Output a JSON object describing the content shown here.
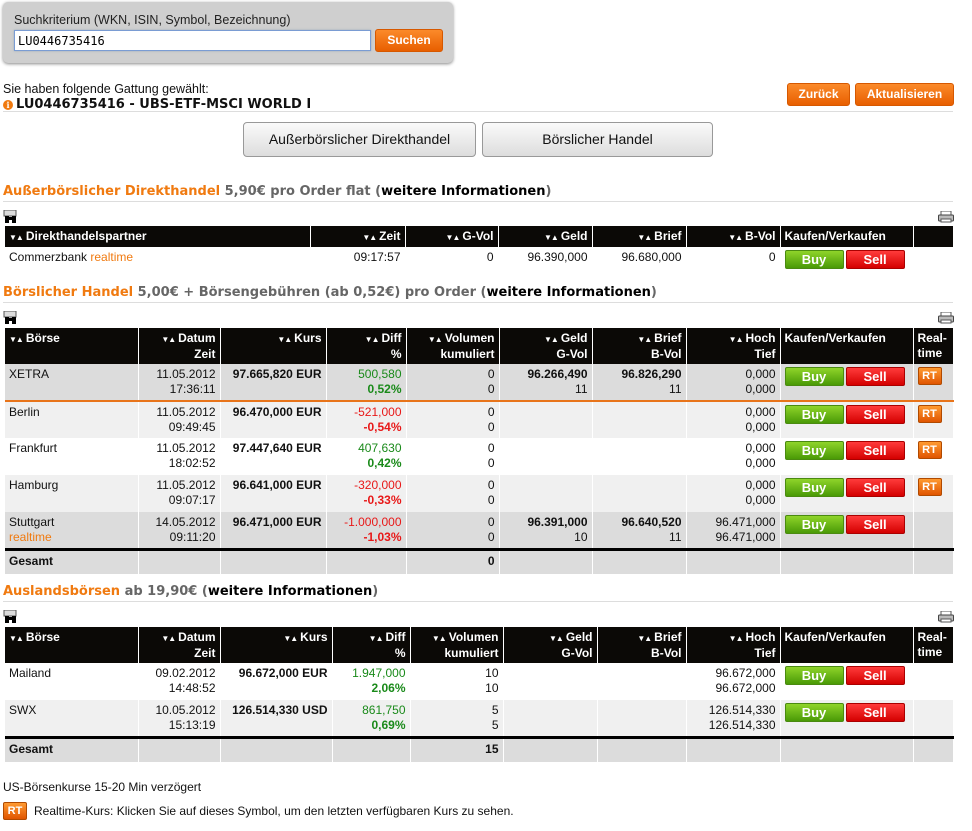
{
  "search": {
    "label": "Suchkriterium (WKN, ISIN, Symbol, Bezeichnung)",
    "value": "LU0446735416",
    "button": "Suchen"
  },
  "selection": {
    "intro": "Sie haben folgende Gattung gewählt:",
    "title": "LU0446735416 - UBS-ETF-MSCI WORLD I"
  },
  "buttons": {
    "back": "Zurück",
    "refresh": "Aktualisieren",
    "otc": "Außerbörslicher Direkthandel",
    "exchange": "Börslicher Handel"
  },
  "labels": {
    "buy": "Buy",
    "sell": "Sell",
    "rt": "RT",
    "gesamt": "Gesamt"
  },
  "sections": {
    "otc": {
      "name": "Außerbörslicher Direkthandel",
      "price": " 5,90€ pro Order flat ",
      "link": "weitere Informationen"
    },
    "exchange": {
      "name": "Börslicher Handel",
      "price": " 5,00€ + Börsengebühren (ab 0,52€) pro Order ",
      "link": "weitere Informationen"
    },
    "foreign": {
      "name": "Auslandsbörsen",
      "price": " ab 19,90€  ",
      "link": "weitere Informationen"
    }
  },
  "otc_table": {
    "headers": [
      "Direkthandelspartner",
      "Zeit",
      "G-Vol",
      "Geld",
      "Brief",
      "B-Vol",
      "Kaufen/Verkaufen",
      ""
    ],
    "rows": [
      {
        "partner": "Commerzbank",
        "partner_sub": "realtime",
        "zeit": "09:17:57",
        "gvol": "0",
        "geld": "96.390,000",
        "brief": "96.680,000",
        "bvol": "0"
      }
    ]
  },
  "exchange_table": {
    "headers": [
      [
        "Börse",
        ""
      ],
      [
        "Datum",
        "Zeit"
      ],
      [
        "Kurs",
        ""
      ],
      [
        "Diff",
        "%"
      ],
      [
        "Volumen",
        "kumuliert"
      ],
      [
        "Geld",
        "G-Vol"
      ],
      [
        "Brief",
        "B-Vol"
      ],
      [
        "Hoch",
        "Tief"
      ],
      [
        "Kaufen/Verkaufen",
        ""
      ],
      [
        "Real-",
        "time"
      ]
    ],
    "rows": [
      {
        "boerse": "XETRA",
        "sub": "",
        "datum": "11.05.2012",
        "zeit": "17:36:11",
        "kurs": "97.665,820 EUR",
        "diff": "500,580",
        "pct": "0,52%",
        "dir": "up",
        "v1": "0",
        "v2": "0",
        "geld": "96.266,490",
        "gvol": "11",
        "brief": "96.826,290",
        "bvol": "11",
        "hoch": "0,000",
        "tief": "0,000",
        "rt": true,
        "style": "hl"
      },
      {
        "boerse": "Berlin",
        "sub": "",
        "datum": "11.05.2012",
        "zeit": "09:49:45",
        "kurs": "96.470,000 EUR",
        "diff": "-521,000",
        "pct": "-0,54%",
        "dir": "dn",
        "v1": "0",
        "v2": "0",
        "geld": "",
        "gvol": "",
        "brief": "",
        "bvol": "",
        "hoch": "0,000",
        "tief": "0,000",
        "rt": true,
        "style": "n"
      },
      {
        "boerse": "Frankfurt",
        "sub": "",
        "datum": "11.05.2012",
        "zeit": "18:02:52",
        "kurs": "97.447,640 EUR",
        "diff": "407,630",
        "pct": "0,42%",
        "dir": "up",
        "v1": "0",
        "v2": "0",
        "geld": "",
        "gvol": "",
        "brief": "",
        "bvol": "",
        "hoch": "0,000",
        "tief": "0,000",
        "rt": true,
        "style": "w"
      },
      {
        "boerse": "Hamburg",
        "sub": "",
        "datum": "11.05.2012",
        "zeit": "09:07:17",
        "kurs": "96.641,000 EUR",
        "diff": "-320,000",
        "pct": "-0,33%",
        "dir": "dn",
        "v1": "0",
        "v2": "0",
        "geld": "",
        "gvol": "",
        "brief": "",
        "bvol": "",
        "hoch": "0,000",
        "tief": "0,000",
        "rt": true,
        "style": "n"
      },
      {
        "boerse": "Stuttgart",
        "sub": "realtime",
        "datum": "14.05.2012",
        "zeit": "09:11:20",
        "kurs": "96.471,000 EUR",
        "diff": "-1.000,000",
        "pct": "-1,03%",
        "dir": "dn",
        "v1": "0",
        "v2": "0",
        "geld": "96.391,000",
        "gvol": "10",
        "brief": "96.640,520",
        "bvol": "11",
        "hoch": "96.471,000",
        "tief": "96.471,000",
        "rt": false,
        "style": "hl"
      }
    ],
    "total": "0"
  },
  "foreign_table": {
    "headers": [
      [
        "Börse",
        ""
      ],
      [
        "Datum",
        "Zeit"
      ],
      [
        "Kurs",
        ""
      ],
      [
        "Diff",
        "%"
      ],
      [
        "Volumen",
        "kumuliert"
      ],
      [
        "Geld",
        "G-Vol"
      ],
      [
        "Brief",
        "B-Vol"
      ],
      [
        "Hoch",
        "Tief"
      ],
      [
        "Kaufen/Verkaufen",
        ""
      ],
      [
        "Real-",
        "time"
      ]
    ],
    "rows": [
      {
        "boerse": "Mailand",
        "sub": "",
        "datum": "09.02.2012",
        "zeit": "14:48:52",
        "kurs": "96.672,000 EUR",
        "diff": "1.947,000",
        "pct": "2,06%",
        "dir": "up",
        "v1": "10",
        "v2": "10",
        "geld": "",
        "gvol": "",
        "brief": "",
        "bvol": "",
        "hoch": "96.672,000",
        "tief": "96.672,000",
        "rt": false,
        "style": "w"
      },
      {
        "boerse": "SWX",
        "sub": "",
        "datum": "10.05.2012",
        "zeit": "15:13:19",
        "kurs": "126.514,330 USD",
        "diff": "861,750",
        "pct": "0,69%",
        "dir": "up",
        "v1": "5",
        "v2": "5",
        "geld": "",
        "gvol": "",
        "brief": "",
        "bvol": "",
        "hoch": "126.514,330",
        "tief": "126.514,330",
        "rt": false,
        "style": "n"
      }
    ],
    "total": "15"
  },
  "footer": {
    "delay": "US-Börsenkurse 15-20 Min verzögert",
    "rt_note": "Realtime-Kurs: Klicken Sie auf dieses Symbol, um den letzten verfügbaren Kurs zu sehen."
  },
  "colors": {
    "accent": "#f07a10",
    "up": "#1a8a1a",
    "down": "#e81818",
    "header": "#0b0906"
  }
}
